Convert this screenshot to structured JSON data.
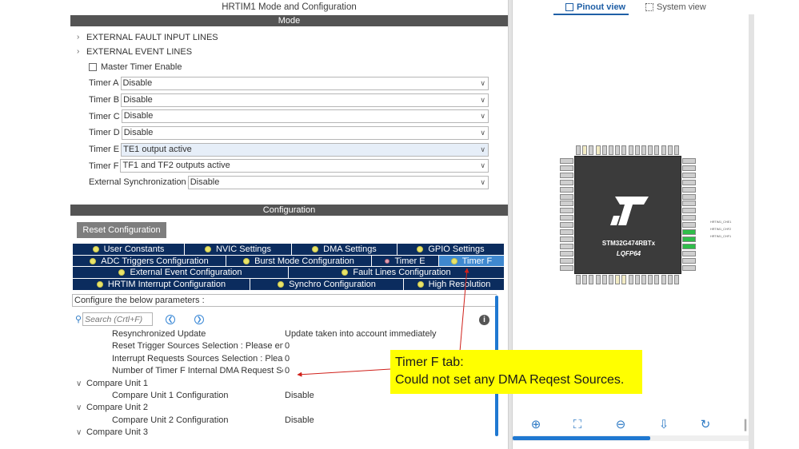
{
  "mode_panel": {
    "title": "HRTIM1 Mode and Configuration",
    "section_mode": "Mode",
    "tree": [
      "EXTERNAL FAULT INPUT LINES",
      "EXTERNAL EVENT LINES"
    ],
    "master_timer_label": "Master Timer Enable",
    "fields": [
      {
        "label": "Timer A",
        "value": "Disable"
      },
      {
        "label": "Timer B",
        "value": "Disable"
      },
      {
        "label": "Timer C",
        "value": "Disable"
      },
      {
        "label": "Timer D",
        "value": "Disable"
      },
      {
        "label": "Timer E",
        "value": "TE1 output active"
      },
      {
        "label": "Timer F",
        "value": "TF1 and TF2 outputs active"
      },
      {
        "label": "External Synchronization",
        "value": "Disable"
      }
    ]
  },
  "config_panel": {
    "section_config": "Configuration",
    "reset_label": "Reset Configuration",
    "tabs_row1": [
      "User Constants",
      "NVIC Settings",
      "DMA Settings",
      "GPIO Settings"
    ],
    "tabs_row2": [
      "ADC Triggers Configuration",
      "Burst Mode Configuration",
      "Timer E",
      "Timer F"
    ],
    "tabs_row3": [
      "External Event Configuration",
      "Fault Lines Configuration"
    ],
    "tabs_row4": [
      "HRTIM Interrupt Configuration",
      "Synchro Configuration",
      "High Resolution"
    ],
    "params_header": "Configure the below parameters :",
    "search_placeholder": "Search (Crtl+F)",
    "params": [
      {
        "name": "Resynchronized Update",
        "value": "Update taken into account immediately"
      },
      {
        "name": "Reset Trigger Sources Selection : Please ent...",
        "value": "0"
      },
      {
        "name": "Interrupt Requests Sources Selection : Pleas...",
        "value": "0"
      },
      {
        "name": "Number of Timer F Internal DMA Request Sou...",
        "value": "0"
      }
    ],
    "group1": "Compare Unit 1",
    "group1_item": {
      "name": "Compare Unit 1 Configuration",
      "value": "Disable"
    },
    "group2": "Compare Unit 2",
    "group2_item": {
      "name": "Compare Unit 2 Configuration",
      "value": "Disable"
    },
    "group3": "Compare Unit 3"
  },
  "right_panel": {
    "pinout_view": "Pinout view",
    "system_view": "System view",
    "chip_name": "STM32G474RBTx",
    "chip_package": "LQFP64",
    "logo_text": "ST",
    "signals": [
      "HRTIM1_CHE1",
      "HRTIM1_CHF2",
      "HRTIM1_CHF1"
    ]
  },
  "callout": {
    "line1": "Timer F tab:",
    "line2": "Could not set any DMA Reqest Sources."
  },
  "colors": {
    "tab_bg": "#0b2c5e",
    "tab_active": "#3f88cf",
    "callout_bg": "#ffff00",
    "arrow": "#d0201a",
    "section_bar": "#545454"
  }
}
